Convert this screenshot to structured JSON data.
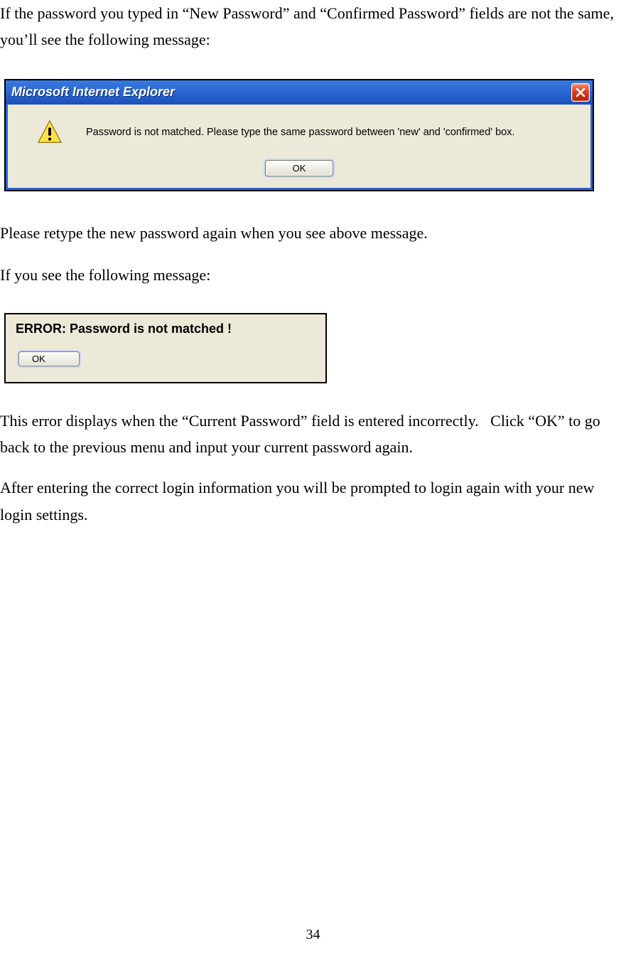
{
  "paragraphs": {
    "p1": "If the password you typed in “New Password” and “Confirmed Password” fields are not the same, you’ll see the following message:",
    "p2": "Please retype the new password again when you see above message.",
    "p3": "If you see the following message:",
    "p4": "This error displays when the “Current Password” field is entered incorrectly.   Click “OK” to go back to the previous menu and input your current password again.",
    "p5": "After entering the correct login information you will be prompted to login again with your new login settings."
  },
  "dialog1": {
    "title": "Microsoft Internet Explorer",
    "message": "Password is not matched. Please type the same password between 'new' and 'confirmed' box.",
    "ok_label": "OK"
  },
  "dialog2": {
    "message": "ERROR: Password is not matched !",
    "ok_label": "OK"
  },
  "page_number": "34"
}
